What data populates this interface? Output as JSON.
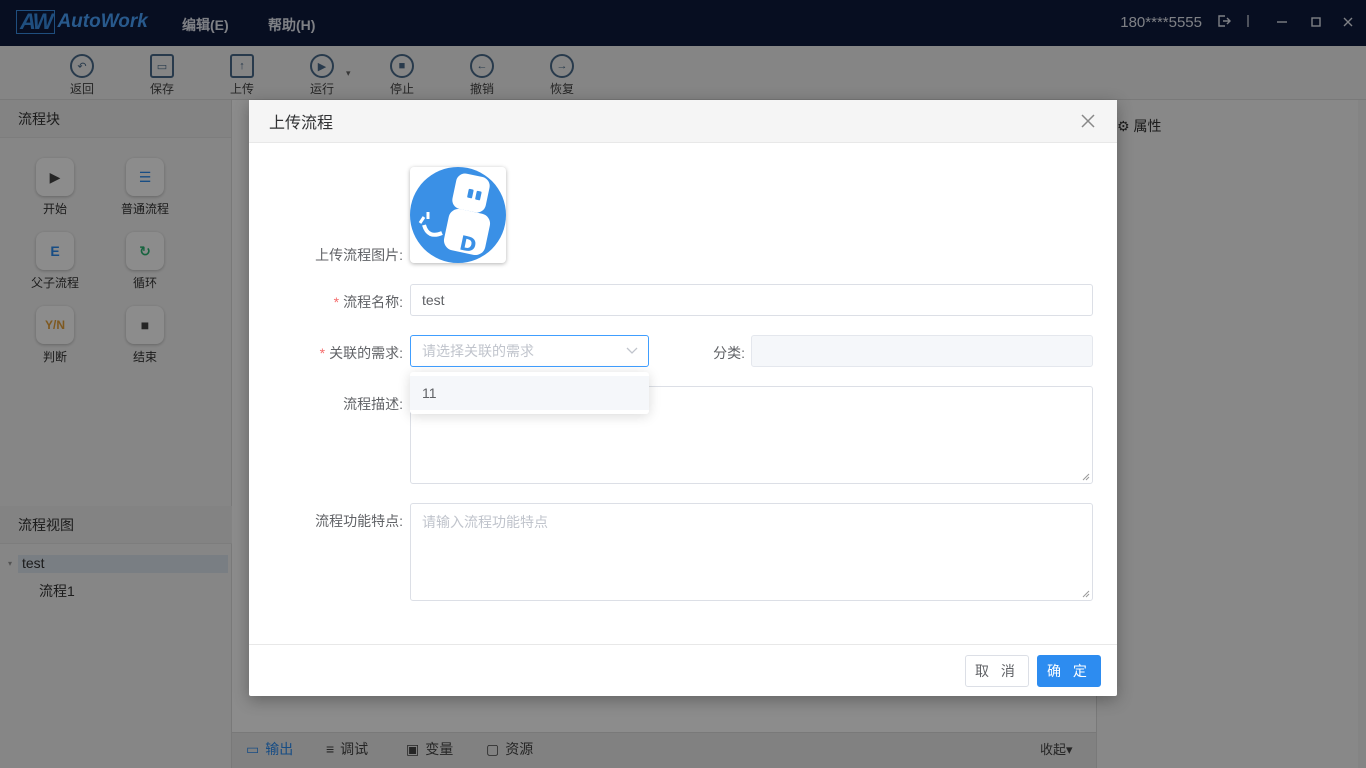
{
  "app": {
    "logo_mark": "AW",
    "logo_name": "AutoWork"
  },
  "menu": {
    "edit": "编辑(E)",
    "help": "帮助(H)"
  },
  "user": {
    "phone": "180****5555"
  },
  "toolbar": {
    "back": "返回",
    "save": "保存",
    "upload": "上传",
    "run": "运行",
    "stop": "停止",
    "undo": "撤销",
    "redo": "恢复"
  },
  "left_panel": {
    "blocks_title": "流程块",
    "blocks": {
      "start": "开始",
      "normal": "普通流程",
      "parent_child": "父子流程",
      "loop": "循环",
      "judge": "判断",
      "end": "结束",
      "judge_icon": "Y/N"
    },
    "view_title": "流程视图",
    "tree": {
      "root": "test",
      "child": "流程1"
    }
  },
  "right_panel": {
    "title": "属性"
  },
  "bottom_tabs": {
    "output": "输出",
    "debug": "调试",
    "variables": "变量",
    "resources": "资源",
    "collapse": "收起▾"
  },
  "modal": {
    "title": "上传流程",
    "labels": {
      "image": "上传流程图片:",
      "name": "流程名称:",
      "requirement": "关联的需求:",
      "category": "分类:",
      "description": "流程描述:",
      "features": "流程功能特点:"
    },
    "required_mark": "*",
    "fields": {
      "name_value": "test",
      "requirement_placeholder": "请选择关联的需求",
      "features_placeholder": "请输入流程功能特点"
    },
    "dropdown_options": [
      "11"
    ],
    "buttons": {
      "cancel": "取 消",
      "ok": "确 定"
    }
  },
  "colors": {
    "primary": "#2d8cf0",
    "titlebar": "#0e1a3c",
    "required": "#f56c6c"
  }
}
